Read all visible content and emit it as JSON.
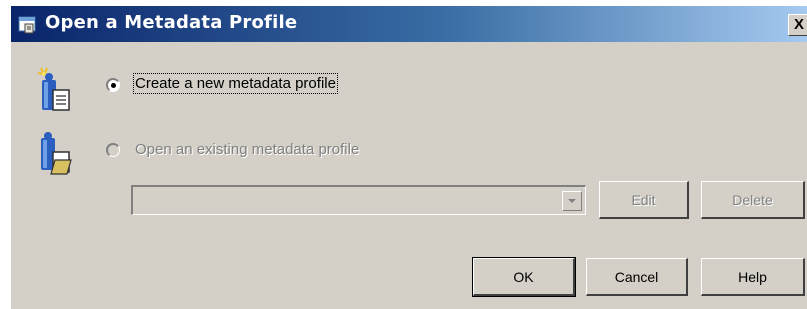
{
  "window": {
    "title": "Open a Metadata Profile",
    "close_symbol": "X",
    "title_icon": "metadata-window-icon"
  },
  "options": {
    "create": {
      "label": "Create a new metadata profile",
      "selected": true,
      "icon": "new-profile-icon"
    },
    "open_existing": {
      "label": "Open an existing metadata profile",
      "selected": false,
      "enabled": false,
      "icon": "open-profile-icon"
    }
  },
  "profile_select": {
    "value": "",
    "enabled": false
  },
  "buttons": {
    "edit": "Edit",
    "delete": "Delete",
    "ok": "OK",
    "cancel": "Cancel",
    "help": "Help"
  }
}
